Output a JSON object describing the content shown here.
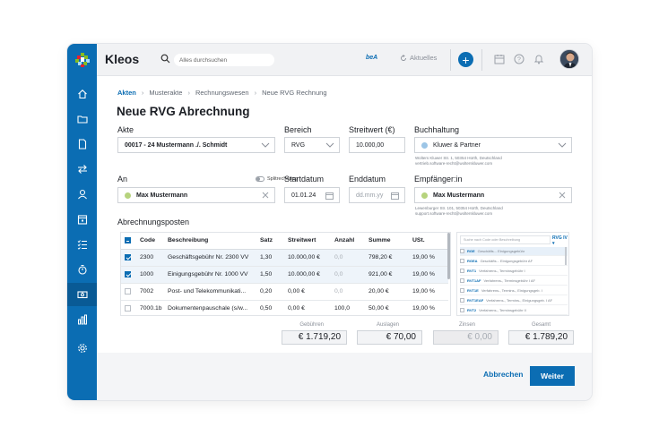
{
  "app": {
    "name": "Kleos"
  },
  "topbar": {
    "search_placeholder": "Alles durchsuchen",
    "bea_label": "beA",
    "news_label": "Aktuelles"
  },
  "sidebar": {
    "items": [
      "home-icon",
      "folder-icon",
      "document-icon",
      "transfer-icon",
      "contacts-icon",
      "calendar-icon",
      "tasks-icon",
      "timer-icon",
      "billing-icon",
      "reports-icon",
      "settings-icon"
    ],
    "active": "billing-icon"
  },
  "breadcrumb": [
    "Akten",
    "Musterakte",
    "Rechnungswesen",
    "Neue RVG Rechnung"
  ],
  "page_title": "Neue RVG Abrechnung",
  "form": {
    "akte": {
      "label": "Akte",
      "value": "00017 - 24 Mustermann ./. Schmidt"
    },
    "bereich": {
      "label": "Bereich",
      "value": "RVG"
    },
    "streitwert": {
      "label": "Streitwert (€)",
      "value": "10.000,00"
    },
    "buchhaltung": {
      "label": "Buchhaltung",
      "value": "Kluwer & Partner",
      "address1": "Wolters Kluwer Str. 1, 50354 Hürth, Deutschland",
      "address2": "vertrieb.software-recht@wolterskluwer.com"
    },
    "an": {
      "label": "An",
      "value": "Max Mustermann"
    },
    "splitrechnung_label": "Splitrechnung",
    "startdatum": {
      "label": "Startdatum",
      "value": "01.01.24"
    },
    "enddatum": {
      "label": "Enddatum",
      "placeholder": "dd.mm.yy"
    },
    "empfaenger": {
      "label": "Empfänger:in",
      "value": "Max Mustermann",
      "address1": "Lewenburger Str. 101, 50354 Hürth, Deutschland",
      "address2": "support.software-recht@wolterskluwer.com"
    }
  },
  "positions": {
    "title": "Abrechnungsposten",
    "columns": [
      "Code",
      "Beschreibung",
      "Satz",
      "Streitwert",
      "Anzahl",
      "Summe",
      "USt."
    ],
    "rows": [
      {
        "checked": true,
        "code": "2300",
        "desc": "Geschäftsgebühr Nr. 2300 VV",
        "satz": "1,30",
        "streitwert": "10.000,00 €",
        "anzahl": "0,0",
        "summe": "798,20 €",
        "ust": "19,00 %"
      },
      {
        "checked": true,
        "code": "1000",
        "desc": "Einigungsgebühr Nr. 1000 VV",
        "satz": "1,50",
        "streitwert": "10.000,00 €",
        "anzahl": "0,0",
        "summe": "921,00 €",
        "ust": "19,00 %"
      },
      {
        "checked": false,
        "code": "7002",
        "desc": "Post- und Telekommunikati...",
        "satz": "0,20",
        "streitwert": "0,00 €",
        "anzahl": "0,0",
        "summe": "20,00 €",
        "ust": "19,00 %"
      },
      {
        "checked": false,
        "code": "7000.1b",
        "desc": "Dokumentenpauschale (s/w...",
        "satz": "0,50",
        "streitwert": "0,00 €",
        "anzahl": "100,0",
        "summe": "50,00 €",
        "ust": "19,00 %"
      }
    ]
  },
  "fee_panel": {
    "search_placeholder": "Suche nach Code oder Beschreibung",
    "filter": "RVG IV",
    "items": [
      {
        "code": "RGE",
        "text": "Geschäfts... Einigungsgebühr",
        "selected": true
      },
      {
        "code": "RGEA",
        "text": "Geschäfts... Einigungsgebühr AF"
      },
      {
        "code": "RVT1",
        "text": "Verfahrens-, Terminsgebühr I"
      },
      {
        "code": "RVT1AF",
        "text": "Verfahrens-, Terminsgebühr I AF"
      },
      {
        "code": "RVT1E",
        "text": "Verfahrens-, Termins-, Einigungsgeb. I"
      },
      {
        "code": "RVT1EAF",
        "text": "Verfahrens-, Termins-, Einigungsgeb. I AF"
      },
      {
        "code": "RVT2",
        "text": "Verfahrens-, Terminsgebühr II"
      }
    ]
  },
  "totals": [
    {
      "label": "Gebühren",
      "value": "€ 1.719,20",
      "disabled": false
    },
    {
      "label": "Auslagen",
      "value": "€ 70,00",
      "disabled": false
    },
    {
      "label": "Zinsen",
      "value": "€ 0,00",
      "disabled": true
    },
    {
      "label": "Gesamt",
      "value": "€ 1.789,20",
      "disabled": false
    }
  ],
  "actions": {
    "cancel": "Abbrechen",
    "next": "Weiter"
  },
  "colors": {
    "brand": "#0b6db3",
    "sidebar_active": "#095a95"
  }
}
